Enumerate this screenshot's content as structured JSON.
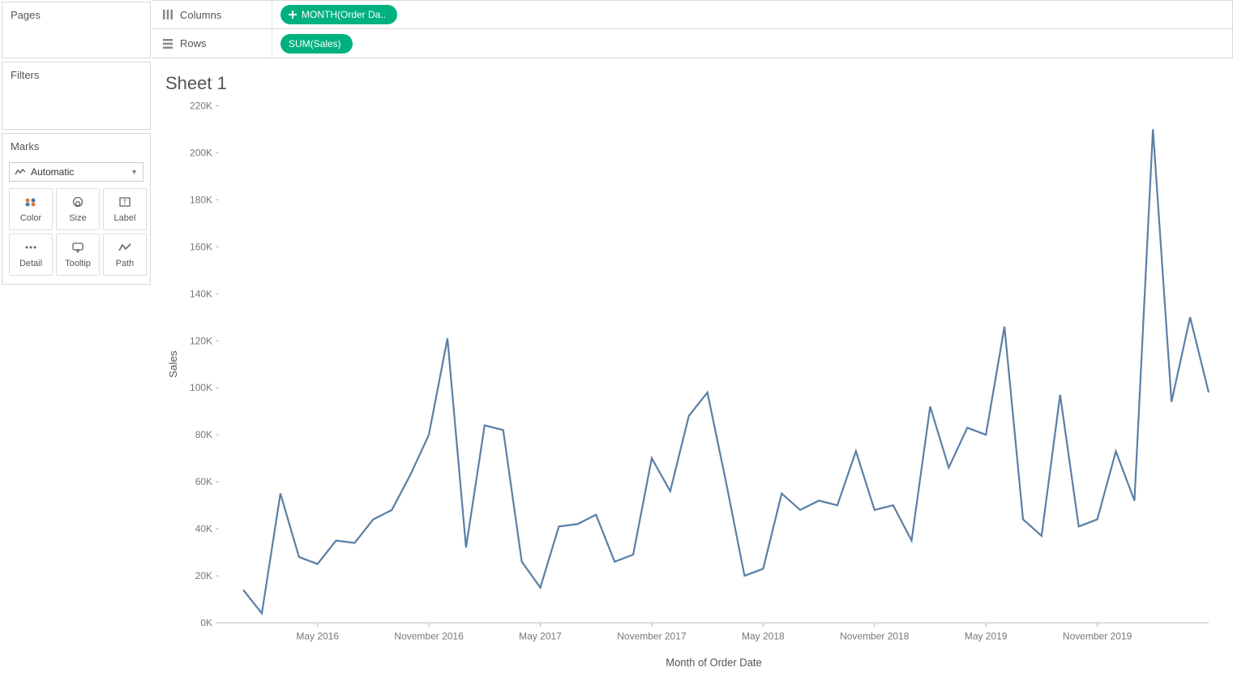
{
  "panels": {
    "pages": "Pages",
    "filters": "Filters",
    "marks": "Marks"
  },
  "marks": {
    "type_label": "Automatic",
    "cards": [
      {
        "id": "color",
        "label": "Color"
      },
      {
        "id": "size",
        "label": "Size"
      },
      {
        "id": "label",
        "label": "Label"
      },
      {
        "id": "detail",
        "label": "Detail"
      },
      {
        "id": "tooltip",
        "label": "Tooltip"
      },
      {
        "id": "path",
        "label": "Path"
      }
    ]
  },
  "shelves": {
    "columns_label": "Columns",
    "rows_label": "Rows",
    "columns_pill": "MONTH(Order Da..",
    "rows_pill": "SUM(Sales)"
  },
  "sheet": {
    "title": "Sheet 1"
  },
  "chart_data": {
    "type": "line",
    "xlabel": "Month of Order Date",
    "ylabel": "Sales",
    "ylim": [
      0,
      220000
    ],
    "y_ticks": [
      0,
      20000,
      40000,
      60000,
      80000,
      100000,
      120000,
      140000,
      160000,
      180000,
      200000,
      220000
    ],
    "y_tick_labels": [
      "0K",
      "20K",
      "40K",
      "60K",
      "80K",
      "100K",
      "120K",
      "140K",
      "160K",
      "180K",
      "200K",
      "220K"
    ],
    "x_tick_indices": [
      4,
      10,
      16,
      22,
      28,
      34,
      40,
      46
    ],
    "x_tick_labels": [
      "May 2016",
      "November 2016",
      "May 2017",
      "November 2017",
      "May 2018",
      "November 2018",
      "May 2019",
      "November 2019"
    ],
    "series": [
      {
        "name": "Sales",
        "values": [
          14000,
          4000,
          55000,
          28000,
          25000,
          35000,
          34000,
          44000,
          48000,
          63000,
          80000,
          121000,
          32000,
          84000,
          82000,
          26000,
          15000,
          41000,
          42000,
          46000,
          26000,
          29000,
          70000,
          56000,
          88000,
          98000,
          60000,
          20000,
          23000,
          55000,
          48000,
          52000,
          50000,
          73000,
          48000,
          50000,
          35000,
          92000,
          66000,
          83000,
          80000,
          126000,
          44000,
          37000,
          97000,
          41000,
          44000,
          73000,
          52000,
          210000,
          94000,
          130000,
          98000
        ]
      }
    ]
  }
}
